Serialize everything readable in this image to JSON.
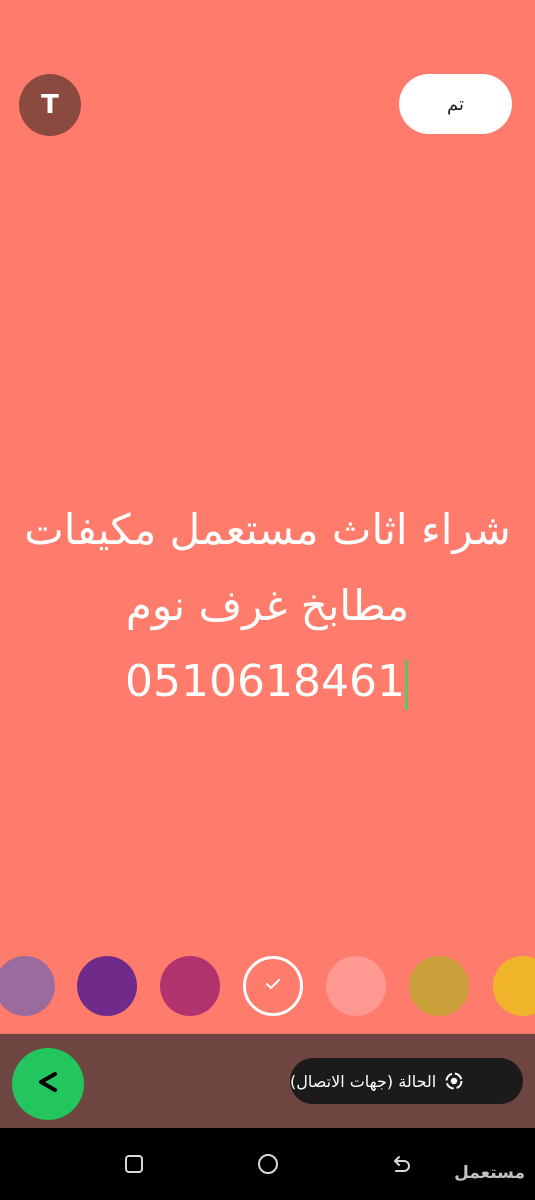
{
  "header": {
    "font_button_label": "T",
    "done_label": "تم"
  },
  "status_text": {
    "line1": "شراء اثاث مستعمل مكيفات",
    "line2": "مطابخ غرف نوم",
    "line3": "0510618461"
  },
  "colors": {
    "background": "#ff7b6b",
    "font_button": "#8b4a40",
    "bottom_bar": "#6e4540",
    "send_button": "#22c55e",
    "cursor": "#5fc55a"
  },
  "palette": [
    {
      "name": "mauve",
      "color": "#9c6b9e",
      "selected": false
    },
    {
      "name": "purple",
      "color": "#6f2a8a",
      "selected": false
    },
    {
      "name": "magenta",
      "color": "#b0336e",
      "selected": false
    },
    {
      "name": "coral",
      "color": "#ff7b6b",
      "selected": true
    },
    {
      "name": "light-pink",
      "color": "#ff9890",
      "selected": false
    },
    {
      "name": "mustard",
      "color": "#c9a03a",
      "selected": false
    },
    {
      "name": "yellow",
      "color": "#f0b42a",
      "selected": false
    }
  ],
  "footer": {
    "audience_label": "الحالة (جهات الاتصال)",
    "audience_icon": "status-ring-icon",
    "send_icon": "send-arrow-icon"
  },
  "nav": {
    "icons": [
      "recents-icon",
      "home-icon",
      "back-icon"
    ]
  },
  "watermark": "مستعمل"
}
